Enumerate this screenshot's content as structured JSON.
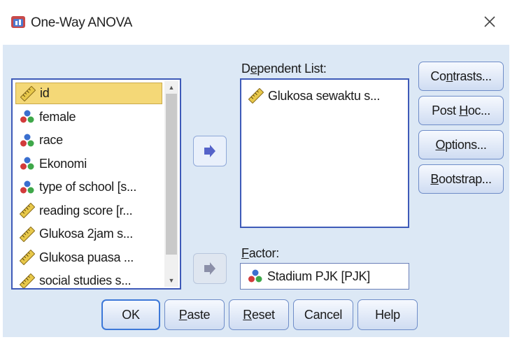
{
  "window": {
    "title": "One-Way ANOVA",
    "icon": "spss-app-icon",
    "close_icon": "close-icon"
  },
  "variable_list": {
    "items": [
      {
        "label": "id",
        "icon": "ruler-icon",
        "selected": true
      },
      {
        "label": "female",
        "icon": "nominal-icon",
        "selected": false
      },
      {
        "label": "race",
        "icon": "nominal-icon",
        "selected": false
      },
      {
        "label": "Ekonomi",
        "icon": "nominal-icon",
        "selected": false
      },
      {
        "label": "type of school [s...",
        "icon": "nominal-icon",
        "selected": false
      },
      {
        "label": "reading score [r...",
        "icon": "ruler-icon",
        "selected": false
      },
      {
        "label": "Glukosa 2jam s...",
        "icon": "ruler-icon",
        "selected": false
      },
      {
        "label": "Glukosa puasa ...",
        "icon": "ruler-icon",
        "selected": false
      },
      {
        "label": "social studies s...",
        "icon": "ruler-icon",
        "selected": false
      }
    ]
  },
  "dependent_list": {
    "label_pre": "D",
    "label_u": "e",
    "label_post": "pendent List:",
    "items": [
      {
        "label": "Glukosa sewaktu s...",
        "icon": "ruler-icon"
      }
    ]
  },
  "factor": {
    "label_pre": "",
    "label_u": "F",
    "label_post": "actor:",
    "value": "Stadium PJK [PJK]",
    "icon": "nominal-icon"
  },
  "side_buttons": {
    "contrasts": {
      "pre": "Co",
      "u": "n",
      "post": "trasts..."
    },
    "post_hoc": {
      "pre": "Post ",
      "u": "H",
      "post": "oc..."
    },
    "options": {
      "pre": "",
      "u": "O",
      "post": "ptions..."
    },
    "bootstrap": {
      "pre": "",
      "u": "B",
      "post": "ootstrap..."
    }
  },
  "bottom_buttons": {
    "ok": "OK",
    "paste": {
      "u": "P",
      "post": "aste"
    },
    "reset": {
      "u": "R",
      "post": "eset"
    },
    "cancel": "Cancel",
    "help": "Help"
  },
  "colors": {
    "dialog_bg": "#dce8f5",
    "selection": "#f4d877",
    "list_border": "#3e5ab8",
    "arrow": "#5563c9"
  }
}
